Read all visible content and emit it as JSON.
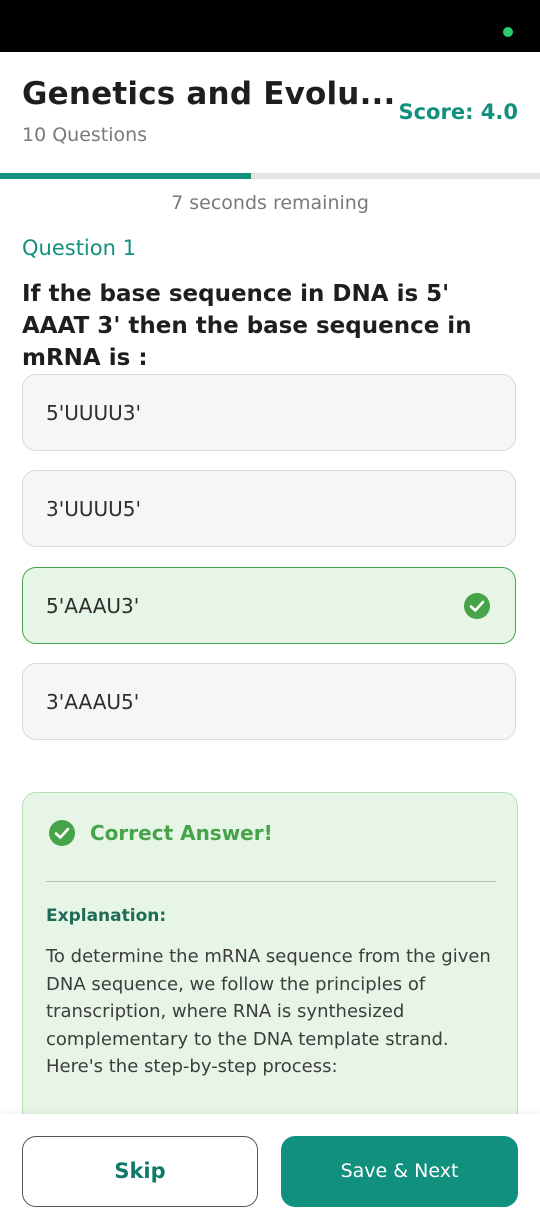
{
  "header": {
    "title": "Genetics and Evolu...",
    "subtitle": "10 Questions",
    "score": "Score: 4.0"
  },
  "progress": {
    "fraction": 0.465
  },
  "timer": "7 seconds remaining",
  "question": {
    "number_label": "Question 1",
    "text": "If the base sequence in DNA is 5' AAAT 3' then the base sequence in mRNA is :"
  },
  "options": [
    {
      "label": "5'UUUU3'",
      "state": "default"
    },
    {
      "label": "3'UUUU5'",
      "state": "default"
    },
    {
      "label": "5'AAAU3'",
      "state": "correct"
    },
    {
      "label": "3'AAAU5'",
      "state": "default"
    }
  ],
  "answer": {
    "title": "Correct Answer!",
    "explanation_heading": "Explanation:",
    "explanation_text": "To determine the mRNA sequence from the given DNA sequence, we follow the principles of transcription, where RNA is synthesized complementary to the DNA template strand. Here's the step-by-step process:"
  },
  "footer": {
    "skip_label": "Skip",
    "next_label": "Save & Next"
  },
  "colors": {
    "accent": "#12907e",
    "correct": "#46a349",
    "correct_bg": "#e6f5e6"
  },
  "icons": {
    "correct": "check-circle-icon"
  }
}
